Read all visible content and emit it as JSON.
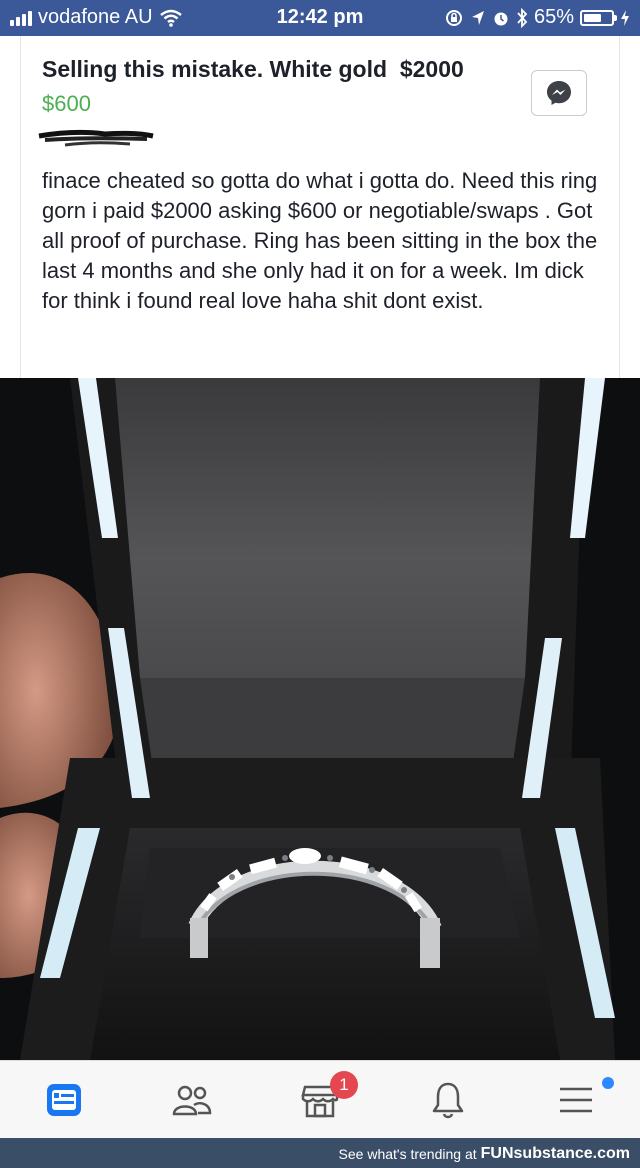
{
  "status_bar": {
    "carrier": "vodafone AU",
    "time": "12:42 pm",
    "battery": "65%",
    "battery_level": 0.65,
    "icons": [
      "signal-icon",
      "wifi-icon",
      "rotation-lock-icon",
      "location-icon",
      "alarm-icon",
      "bluetooth-icon",
      "battery-icon",
      "charging-icon"
    ]
  },
  "post": {
    "title": "Selling this mistake. White gold  $2000",
    "price": "$600",
    "body": "finace cheated so gotta do what i gotta do. Need this ring gorn i paid $2000 asking $600 or negotiable/swaps . Got all proof of purchase. Ring has been sitting in the box the last 4 months and she only had it on for a week. Im dick for think i found real love haha shit dont exist.",
    "icons": [
      "messenger-icon"
    ]
  },
  "bottom_nav": {
    "items": [
      {
        "name": "news-feed-icon",
        "active": true
      },
      {
        "name": "friends-icon"
      },
      {
        "name": "marketplace-icon",
        "badge": "1"
      },
      {
        "name": "notifications-bell-icon"
      },
      {
        "name": "menu-icon"
      }
    ]
  },
  "footer": {
    "text": "See what's trending at",
    "brand_prefix": "FUN",
    "brand_suffix": "substance",
    "brand_tld": ".com"
  },
  "colors": {
    "status_bar": "#3b5998",
    "price": "#4caf50",
    "active_nav": "#1877f2",
    "badge": "#e4474f",
    "footer": "#3b4e68"
  }
}
